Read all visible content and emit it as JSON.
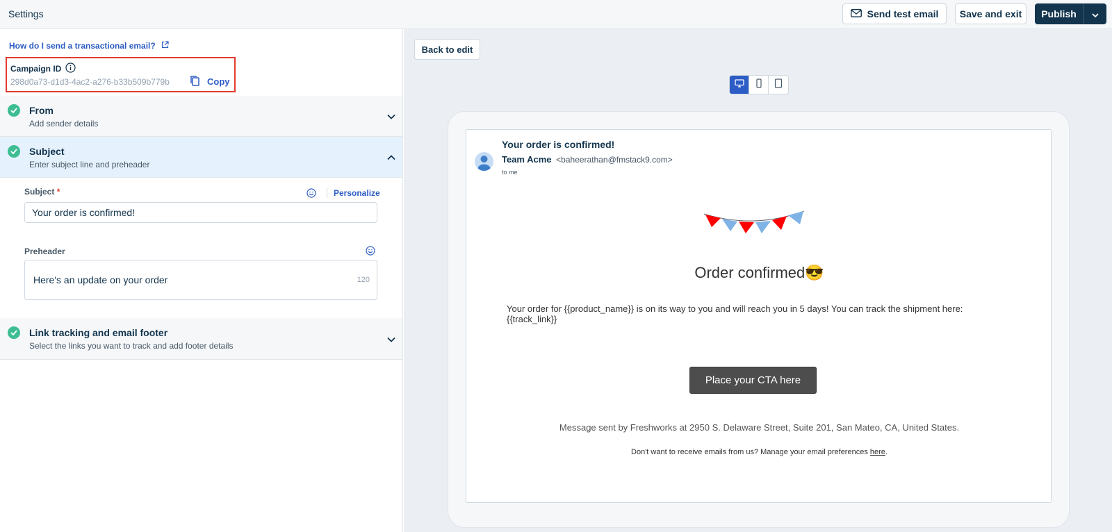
{
  "header": {
    "title": "Settings",
    "send_test_label": "Send test email",
    "save_exit_label": "Save and exit",
    "publish_label": "Publish"
  },
  "left": {
    "help_link": "How do I send a transactional email?",
    "campaign": {
      "label": "Campaign ID",
      "id": "298d0a73-d1d3-4ac2-a276-b33b509b779b",
      "copy_label": "Copy"
    },
    "sections": [
      {
        "title": "From",
        "subtitle": "Add sender details",
        "expanded": false
      },
      {
        "title": "Subject",
        "subtitle": "Enter subject line and preheader",
        "expanded": true
      },
      {
        "title": "Link tracking and email footer",
        "subtitle": "Select the links you want to track and add footer details",
        "expanded": false
      }
    ],
    "subject_form": {
      "subject_label": "Subject",
      "required_mark": "*",
      "personalize_label": "Personalize",
      "subject_value": "Your order is confirmed!",
      "preheader_label": "Preheader",
      "preheader_value": "Here's an update on your order",
      "preheader_counter": "120"
    }
  },
  "preview": {
    "back_label": "Back to edit",
    "devices": [
      "desktop-icon",
      "mobile-icon",
      "tablet-icon"
    ],
    "active_device": "desktop",
    "email": {
      "subject": "Your order is confirmed!",
      "sender_name": "Team Acme",
      "sender_email": "<baheerathan@fmstack9.com>",
      "to": "to me",
      "heading": "Order confirmed😎",
      "body": "Your order for {{product_name}} is on its way to you and will reach you in 5 days! You can track the shipment here: {{track_link}}",
      "cta": "Place your CTA here",
      "footer_address": "Message sent by Freshworks at 2950 S. Delaware Street, Suite 201, San Mateo, CA, United States.",
      "footer_pref_text": "Don't want to receive emails from us? Manage your email preferences",
      "footer_pref_link": "here",
      "footer_pref_end": "."
    }
  },
  "colors": {
    "primary": "#12344d",
    "link": "#2c5cc5",
    "success": "#3ebd93",
    "highlight": "#e23b2e"
  }
}
